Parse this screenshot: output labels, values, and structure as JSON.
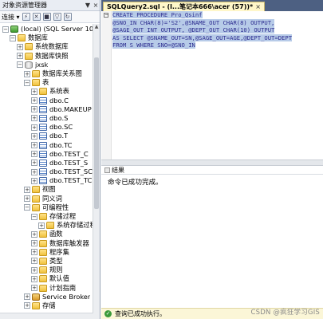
{
  "object_explorer": {
    "title": "对象资源管理器",
    "pin_glyph": "▼",
    "close_glyph": "×",
    "toolbar": {
      "connect_label": "连接 ▾"
    },
    "tree": [
      {
        "level": 0,
        "exp": "⊟",
        "icon": "server",
        "name": "server-node",
        "label": "(local) (SQL Server 10.50.1600"
      },
      {
        "level": 1,
        "exp": "⊟",
        "icon": "folder",
        "name": "databases-folder",
        "label": "数据库"
      },
      {
        "level": 2,
        "exp": "⊞",
        "icon": "folder",
        "name": "system-databases-folder",
        "label": "系统数据库"
      },
      {
        "level": 2,
        "exp": "⊞",
        "icon": "folder",
        "name": "database-snapshots-folder",
        "label": "数据库快照"
      },
      {
        "level": 2,
        "exp": "⊟",
        "icon": "db",
        "name": "jxsk-database",
        "label": "jxsk"
      },
      {
        "level": 3,
        "exp": "⊞",
        "icon": "folder",
        "name": "database-diagrams-folder",
        "label": "数据库关系图"
      },
      {
        "level": 3,
        "exp": "⊟",
        "icon": "folder",
        "name": "tables-folder",
        "label": "表"
      },
      {
        "level": 4,
        "exp": "⊞",
        "icon": "folder",
        "name": "system-tables-folder",
        "label": "系统表"
      },
      {
        "level": 4,
        "exp": "⊞",
        "icon": "table",
        "name": "table-dbo-c",
        "label": "dbo.C"
      },
      {
        "level": 4,
        "exp": "⊞",
        "icon": "table",
        "name": "table-dbo-makeup",
        "label": "dbo.MAKEUP"
      },
      {
        "level": 4,
        "exp": "⊞",
        "icon": "table",
        "name": "table-dbo-s",
        "label": "dbo.S"
      },
      {
        "level": 4,
        "exp": "⊞",
        "icon": "table",
        "name": "table-dbo-sc",
        "label": "dbo.SC"
      },
      {
        "level": 4,
        "exp": "⊞",
        "icon": "table",
        "name": "table-dbo-t",
        "label": "dbo.T"
      },
      {
        "level": 4,
        "exp": "⊞",
        "icon": "table",
        "name": "table-dbo-tc",
        "label": "dbo.TC"
      },
      {
        "level": 4,
        "exp": "⊞",
        "icon": "table",
        "name": "table-dbo-test-c",
        "label": "dbo.TEST_C"
      },
      {
        "level": 4,
        "exp": "⊞",
        "icon": "table",
        "name": "table-dbo-test-s",
        "label": "dbo.TEST_S"
      },
      {
        "level": 4,
        "exp": "⊞",
        "icon": "table",
        "name": "table-dbo-test-sc",
        "label": "dbo.TEST_SC"
      },
      {
        "level": 4,
        "exp": "⊞",
        "icon": "table",
        "name": "table-dbo-test-tc",
        "label": "dbo.TEST_TC"
      },
      {
        "level": 3,
        "exp": "⊞",
        "icon": "folder",
        "name": "views-folder",
        "label": "视图"
      },
      {
        "level": 3,
        "exp": "⊞",
        "icon": "folder",
        "name": "synonyms-folder",
        "label": "同义词"
      },
      {
        "level": 3,
        "exp": "⊟",
        "icon": "folder",
        "name": "programmability-folder",
        "label": "可编程性"
      },
      {
        "level": 4,
        "exp": "⊟",
        "icon": "folder",
        "name": "stored-procedures-folder",
        "label": "存储过程"
      },
      {
        "level": 5,
        "exp": "⊞",
        "icon": "folder",
        "name": "system-stored-procedures-folder",
        "label": "系统存储过程"
      },
      {
        "level": 4,
        "exp": "⊞",
        "icon": "folder",
        "name": "functions-folder",
        "label": "函数"
      },
      {
        "level": 4,
        "exp": "⊞",
        "icon": "folder",
        "name": "database-triggers-folder",
        "label": "数据库触发器"
      },
      {
        "level": 4,
        "exp": "⊞",
        "icon": "folder",
        "name": "assemblies-folder",
        "label": "程序集"
      },
      {
        "level": 4,
        "exp": "⊞",
        "icon": "folder",
        "name": "types-folder",
        "label": "类型"
      },
      {
        "level": 4,
        "exp": "⊞",
        "icon": "folder",
        "name": "rules-folder",
        "label": "规则"
      },
      {
        "level": 4,
        "exp": "⊞",
        "icon": "folder",
        "name": "defaults-folder",
        "label": "默认值"
      },
      {
        "level": 4,
        "exp": "⊞",
        "icon": "folder",
        "name": "plan-guides-folder",
        "label": "计划指南"
      },
      {
        "level": 3,
        "exp": "⊞",
        "icon": "broker",
        "name": "service-broker-folder",
        "label": "Service Broker"
      },
      {
        "level": 3,
        "exp": "⊞",
        "icon": "folder",
        "name": "storage-folder",
        "label": "存储"
      }
    ]
  },
  "editor": {
    "tab_label": "SQLQuery2.sql - (l...笔记本666\\acer (57))*",
    "tab_close": "×",
    "code_lines": [
      "CREATE PROCEDURE Pro_Qsinf",
      "@SNO_IN CHAR(8)='S2',@SNAME_OUT CHAR(8) OUTPUT,",
      "@SAGE_OUT INT OUTPUT, @DEPT_OUT CHAR(10) OUTPUT",
      "AS SELECT @SNAME_OUT=SN,@SAGE_OUT=AGE,@DEPT_OUT=DEPT",
      "FROM S WHERE SNO=@SNO_IN"
    ],
    "gutter_marks": [
      "⊟",
      "",
      "",
      "",
      ""
    ]
  },
  "results": {
    "tab_label": "结果",
    "message": "命令已成功完成。"
  },
  "status": {
    "text": "查询已成功执行。",
    "ok_glyph": "✓"
  },
  "watermark": "CSDN @疯狂学习GIS"
}
